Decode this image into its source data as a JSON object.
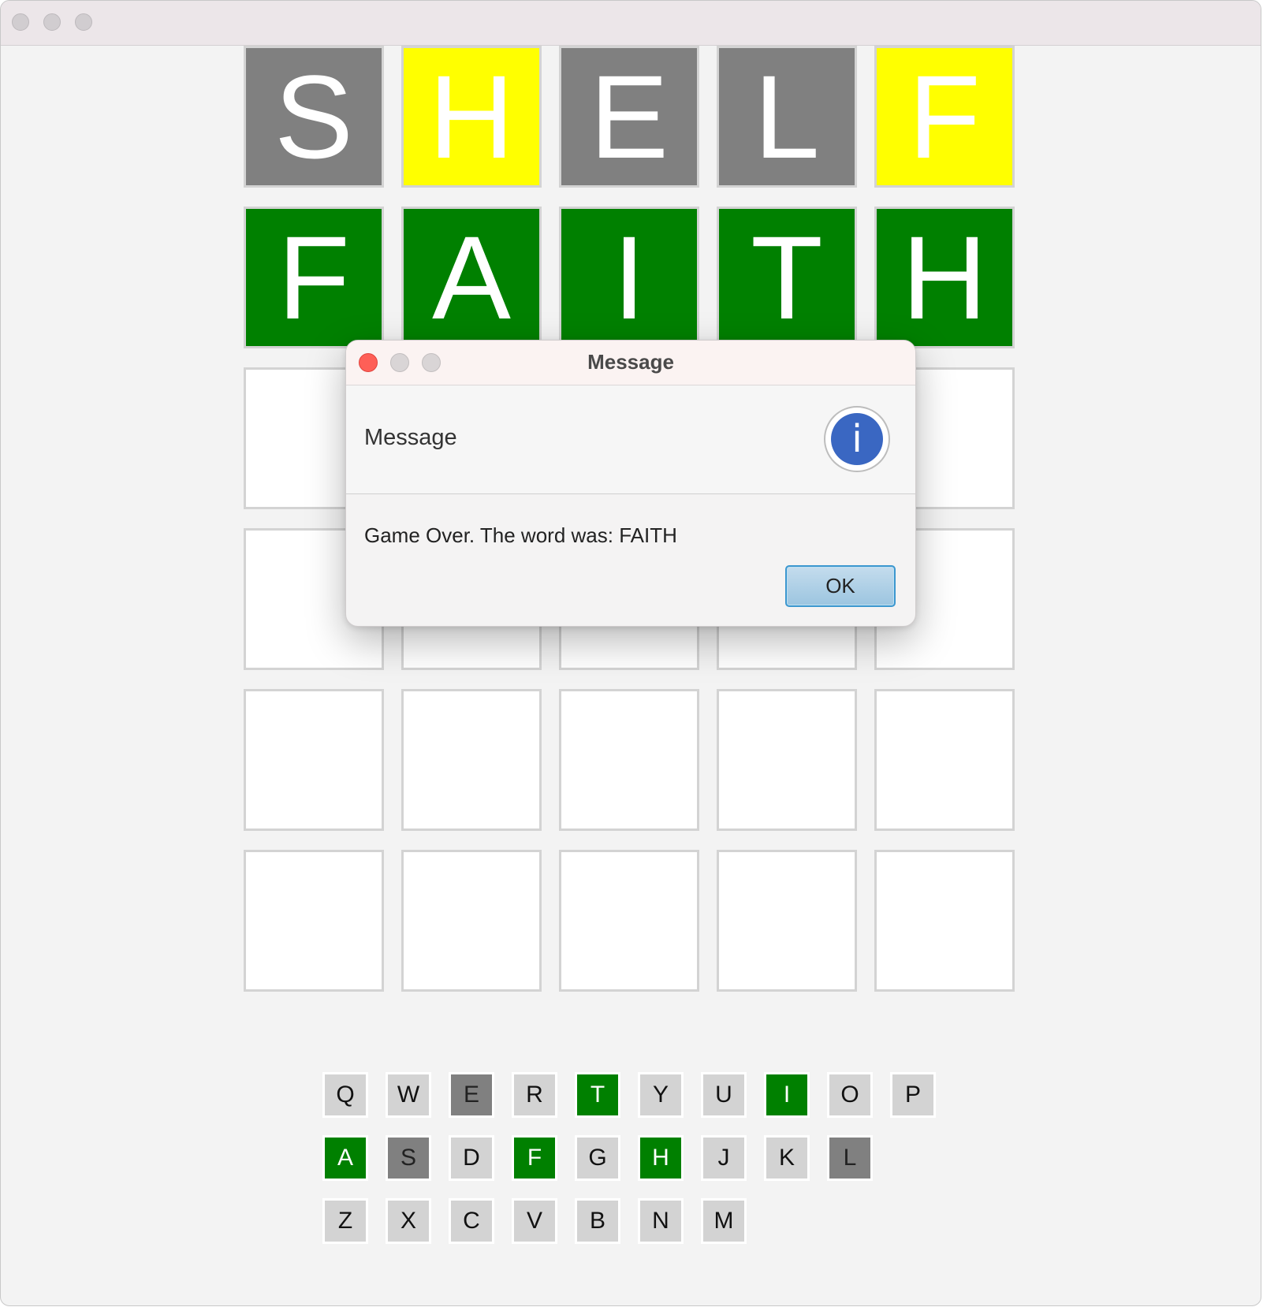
{
  "board": {
    "rows": [
      [
        {
          "letter": "S",
          "state": "gray"
        },
        {
          "letter": "H",
          "state": "yellow"
        },
        {
          "letter": "E",
          "state": "gray"
        },
        {
          "letter": "L",
          "state": "gray"
        },
        {
          "letter": "F",
          "state": "yellow"
        }
      ],
      [
        {
          "letter": "F",
          "state": "green"
        },
        {
          "letter": "A",
          "state": "green"
        },
        {
          "letter": "I",
          "state": "green"
        },
        {
          "letter": "T",
          "state": "green"
        },
        {
          "letter": "H",
          "state": "green"
        }
      ],
      [
        {
          "letter": "",
          "state": "empty"
        },
        {
          "letter": "",
          "state": "empty"
        },
        {
          "letter": "",
          "state": "empty"
        },
        {
          "letter": "",
          "state": "empty"
        },
        {
          "letter": "",
          "state": "empty"
        }
      ],
      [
        {
          "letter": "",
          "state": "empty"
        },
        {
          "letter": "",
          "state": "empty"
        },
        {
          "letter": "",
          "state": "empty"
        },
        {
          "letter": "",
          "state": "empty"
        },
        {
          "letter": "",
          "state": "empty"
        }
      ],
      [
        {
          "letter": "",
          "state": "empty"
        },
        {
          "letter": "",
          "state": "empty"
        },
        {
          "letter": "",
          "state": "empty"
        },
        {
          "letter": "",
          "state": "empty"
        },
        {
          "letter": "",
          "state": "empty"
        }
      ],
      [
        {
          "letter": "",
          "state": "empty"
        },
        {
          "letter": "",
          "state": "empty"
        },
        {
          "letter": "",
          "state": "empty"
        },
        {
          "letter": "",
          "state": "empty"
        },
        {
          "letter": "",
          "state": "empty"
        }
      ]
    ]
  },
  "keyboard": {
    "rows": [
      [
        {
          "key": "Q",
          "state": "default"
        },
        {
          "key": "W",
          "state": "default"
        },
        {
          "key": "E",
          "state": "gray"
        },
        {
          "key": "R",
          "state": "default"
        },
        {
          "key": "T",
          "state": "green"
        },
        {
          "key": "Y",
          "state": "default"
        },
        {
          "key": "U",
          "state": "default"
        },
        {
          "key": "I",
          "state": "green"
        },
        {
          "key": "O",
          "state": "default"
        },
        {
          "key": "P",
          "state": "default"
        }
      ],
      [
        {
          "key": "A",
          "state": "green"
        },
        {
          "key": "S",
          "state": "gray"
        },
        {
          "key": "D",
          "state": "default"
        },
        {
          "key": "F",
          "state": "green"
        },
        {
          "key": "G",
          "state": "default"
        },
        {
          "key": "H",
          "state": "green"
        },
        {
          "key": "J",
          "state": "default"
        },
        {
          "key": "K",
          "state": "default"
        },
        {
          "key": "L",
          "state": "gray"
        }
      ],
      [
        {
          "key": "Z",
          "state": "default"
        },
        {
          "key": "X",
          "state": "default"
        },
        {
          "key": "C",
          "state": "default"
        },
        {
          "key": "V",
          "state": "default"
        },
        {
          "key": "B",
          "state": "default"
        },
        {
          "key": "N",
          "state": "default"
        },
        {
          "key": "M",
          "state": "default"
        }
      ]
    ]
  },
  "dialog": {
    "title": "Message",
    "header": "Message",
    "body": "Game Over. The word was: FAITH",
    "ok_label": "OK",
    "icon": "info-icon",
    "icon_glyph": "i"
  },
  "colors": {
    "green": "#008000",
    "yellow": "#ffff00",
    "gray": "#808080",
    "key_default": "#d3d3d3",
    "close_red": "#fe5f57"
  }
}
